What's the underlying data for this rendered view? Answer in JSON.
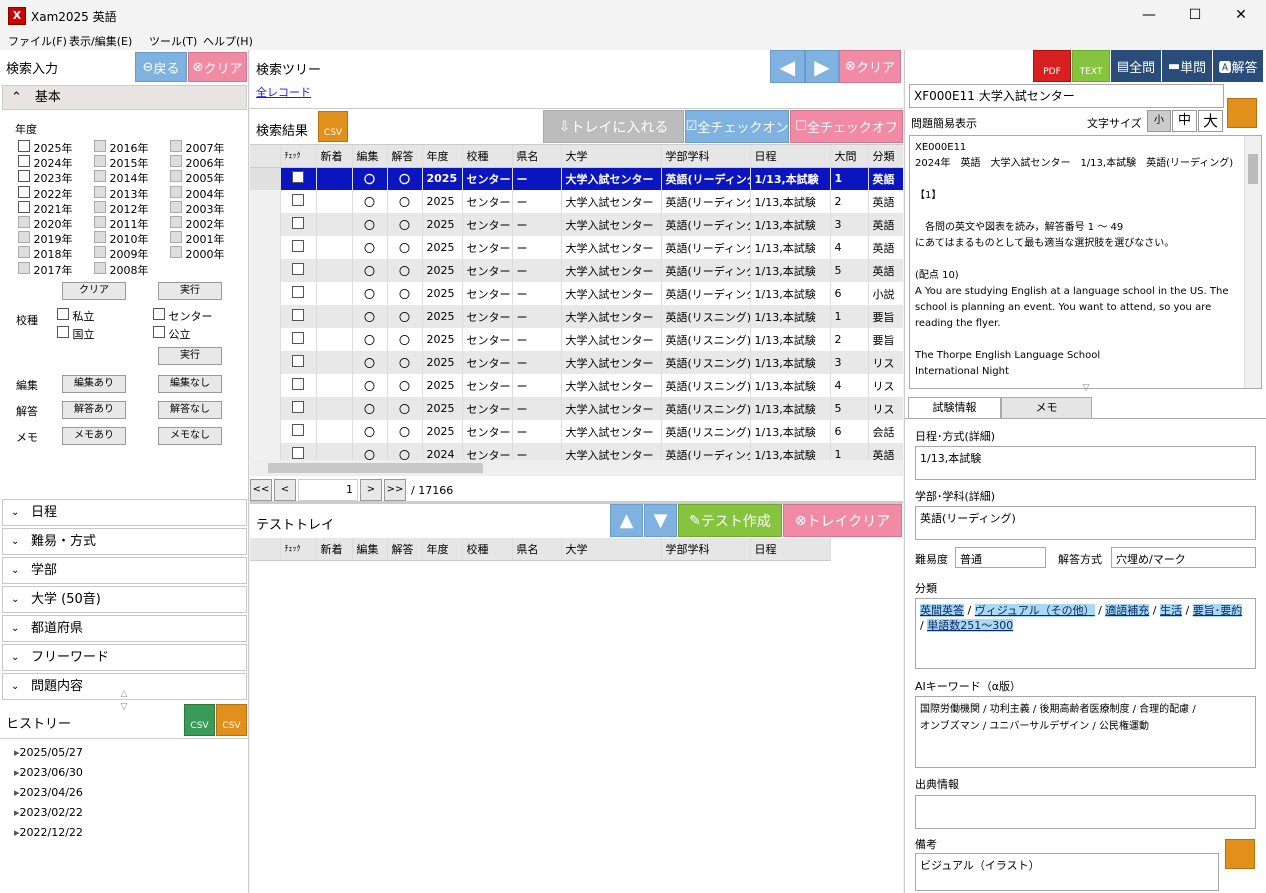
{
  "window": {
    "icon": "X",
    "title": "Xam2025 英語",
    "min": "—",
    "max": "☐",
    "close": "✕"
  },
  "menu": [
    "ファイル(F)",
    "表示/編集(E)",
    "ツール(T)",
    "ヘルプ(H)"
  ],
  "search_input": {
    "title": "検索入力",
    "back": "戻る",
    "clear": "クリア",
    "basic": "基本",
    "year_label": "年度",
    "years": [
      [
        "2025年",
        "2016年",
        "2007年"
      ],
      [
        "2024年",
        "2015年",
        "2006年"
      ],
      [
        "2023年",
        "2014年",
        "2005年"
      ],
      [
        "2022年",
        "2013年",
        "2004年"
      ],
      [
        "2021年",
        "2012年",
        "2003年"
      ],
      [
        "2020年",
        "2011年",
        "2002年"
      ],
      [
        "2019年",
        "2010年",
        "2001年"
      ],
      [
        "2018年",
        "2009年",
        "2000年"
      ],
      [
        "2017年",
        "2008年",
        ""
      ]
    ],
    "clear_btn": "クリア",
    "run_btn": "実行",
    "school_label": "校種",
    "schools": [
      "私立",
      "センター",
      "国立",
      "公立"
    ],
    "run_btn2": "実行",
    "edit_label": "編集",
    "edit_yes": "編集あり",
    "edit_no": "編集なし",
    "ans_label": "解答",
    "ans_yes": "解答あり",
    "ans_no": "解答なし",
    "memo_label": "メモ",
    "memo_yes": "メモあり",
    "memo_no": "メモなし",
    "sections": [
      "日程",
      "難易・方式",
      "学部",
      "大学 (50音)",
      "都道府県",
      "フリーワード",
      "問題内容"
    ]
  },
  "history": {
    "title": "ヒストリー",
    "csv": "CSV",
    "items": [
      "2025/05/27",
      "2023/06/30",
      "2023/04/26",
      "2023/02/22",
      "2022/12/22"
    ]
  },
  "tree": {
    "title": "検索ツリー",
    "clear": "クリア",
    "link": "全レコード"
  },
  "results": {
    "title": "検索結果",
    "csv": "CSV",
    "tray_in": "トレイに入れる",
    "check_on": "全チェックオン",
    "check_off": "全チェックオフ",
    "headers": [
      "ﾁｪｯｸ",
      "新着",
      "編集",
      "解答",
      "年度",
      "校種",
      "県名",
      "大学",
      "学部学科",
      "日程",
      "大問",
      "分類"
    ],
    "rows": [
      [
        "",
        "",
        "〇",
        "〇",
        "2025",
        "センター",
        "ー",
        "大学入試センター",
        "英語(リーディング)",
        "1/13,本試験",
        "1",
        "英語"
      ],
      [
        "",
        "",
        "〇",
        "〇",
        "2025",
        "センター",
        "ー",
        "大学入試センター",
        "英語(リーディング)",
        "1/13,本試験",
        "2",
        "英語"
      ],
      [
        "",
        "",
        "〇",
        "〇",
        "2025",
        "センター",
        "ー",
        "大学入試センター",
        "英語(リーディング)",
        "1/13,本試験",
        "3",
        "英語"
      ],
      [
        "",
        "",
        "〇",
        "〇",
        "2025",
        "センター",
        "ー",
        "大学入試センター",
        "英語(リーディング)",
        "1/13,本試験",
        "4",
        "英語"
      ],
      [
        "",
        "",
        "〇",
        "〇",
        "2025",
        "センター",
        "ー",
        "大学入試センター",
        "英語(リーディング)",
        "1/13,本試験",
        "5",
        "英語"
      ],
      [
        "",
        "",
        "〇",
        "〇",
        "2025",
        "センター",
        "ー",
        "大学入試センター",
        "英語(リーディング)",
        "1/13,本試験",
        "6",
        "小説"
      ],
      [
        "",
        "",
        "〇",
        "〇",
        "2025",
        "センター",
        "ー",
        "大学入試センター",
        "英語(リスニング)",
        "1/13,本試験",
        "1",
        "要旨"
      ],
      [
        "",
        "",
        "〇",
        "〇",
        "2025",
        "センター",
        "ー",
        "大学入試センター",
        "英語(リスニング)",
        "1/13,本試験",
        "2",
        "要旨"
      ],
      [
        "",
        "",
        "〇",
        "〇",
        "2025",
        "センター",
        "ー",
        "大学入試センター",
        "英語(リスニング)",
        "1/13,本試験",
        "3",
        "リス"
      ],
      [
        "",
        "",
        "〇",
        "〇",
        "2025",
        "センター",
        "ー",
        "大学入試センター",
        "英語(リスニング)",
        "1/13,本試験",
        "4",
        "リス"
      ],
      [
        "",
        "",
        "〇",
        "〇",
        "2025",
        "センター",
        "ー",
        "大学入試センター",
        "英語(リスニング)",
        "1/13,本試験",
        "5",
        "リス"
      ],
      [
        "",
        "",
        "〇",
        "〇",
        "2025",
        "センター",
        "ー",
        "大学入試センター",
        "英語(リスニング)",
        "1/13,本試験",
        "6",
        "会話"
      ],
      [
        "",
        "",
        "〇",
        "〇",
        "2024",
        "センター",
        "ー",
        "大学入試センター",
        "英語(リーディング)",
        "1/13,本試験",
        "1",
        "英語"
      ]
    ],
    "pager": {
      "first": "<<",
      "prev": "<",
      "page": "1",
      "next": ">",
      "last": ">>",
      "total": "/ 17166"
    }
  },
  "tray": {
    "title": "テストトレイ",
    "make": "テスト作成",
    "clear": "トレイクリア",
    "headers": [
      "ﾁｪｯｸ",
      "新着",
      "編集",
      "解答",
      "年度",
      "校種",
      "県名",
      "大学",
      "学部学科",
      "日程"
    ]
  },
  "right": {
    "pdf": "PDF",
    "text": "TEXT",
    "all": "全問",
    "single": "単問",
    "answer": "解答",
    "record_title": "XF000E11 大学入試センター",
    "simple": "問題簡易表示",
    "font_size": "文字サイズ",
    "sizes": [
      "小",
      "中",
      "大"
    ],
    "preview": [
      "XE000E11",
      "2024年　英語　大学入試センター　1/13,本試験　英語(リーディング)",
      "",
      "【1】",
      "",
      "　各問の英文や図表を読み，解答番号 1 ～ 49",
      "にあてはまるものとして最も適当な選択肢を選びなさい。",
      "",
      "(配点 10)",
      "A  You are studying English at a language school in the US. The",
      "school is planning an event. You want to attend, so you are",
      "reading the flyer.",
      "",
      "The Thorpe English Language School",
      "International Night"
    ],
    "tabs": [
      "試験情報",
      "メモ"
    ],
    "schedule_label": "日程･方式(詳細)",
    "schedule": "1/13,本試験",
    "dept_label": "学部･学科(詳細)",
    "dept": "英語(リーディング)",
    "difficulty_label": "難易度",
    "difficulty": "普通",
    "method_label": "解答方式",
    "method": "穴埋め/マーク",
    "class_label": "分類",
    "class_tags": [
      "英間英答",
      "ヴィジュアル（その他）",
      "適語補充",
      "生活",
      "要旨･要約",
      "単語数251～300"
    ],
    "ai_label": "AIキーワード（α版）",
    "ai_line1": "国際労働機関 / 功利主義 / 後期高齢者医療制度 / 合理的配慮 /",
    "ai_line2": "オンブズマン / ユニバーサルデザイン / 公民権運動",
    "source_label": "出典情報",
    "source": "",
    "note_label": "備考",
    "note": "ビジュアル（イラスト）"
  }
}
